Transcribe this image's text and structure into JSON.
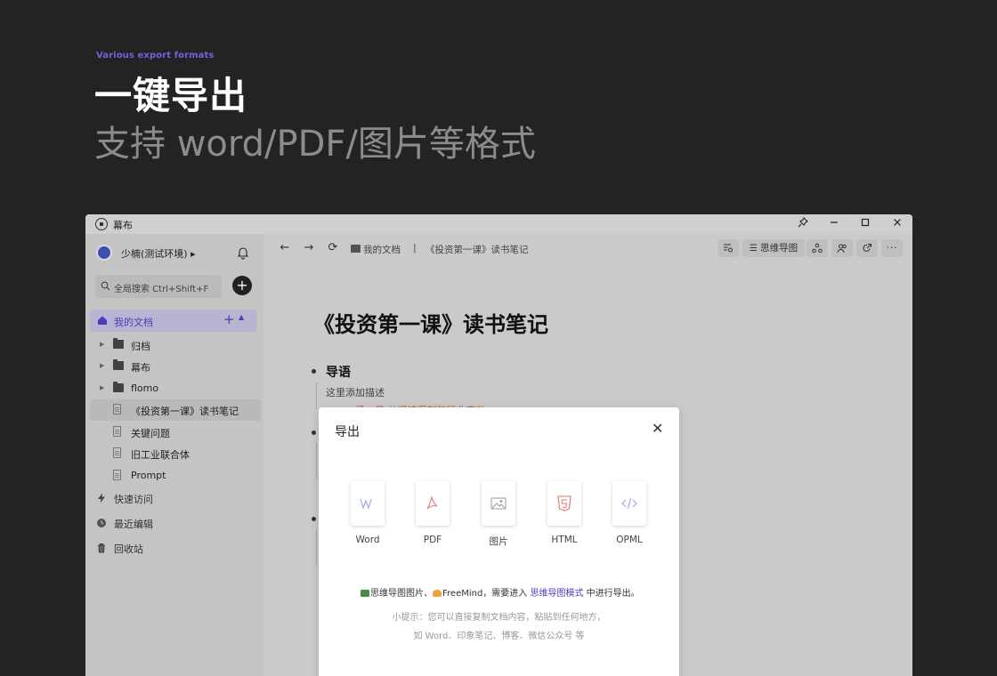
{
  "hero": {
    "tag": "Various export formats",
    "title": "一键导出",
    "subtitle": "支持 word/PDF/图片等格式"
  },
  "window": {
    "app_name": "幕布",
    "controls": [
      "pin-icon",
      "minimize-icon",
      "maximize-icon",
      "close-icon"
    ]
  },
  "sidebar": {
    "user_name": "少楠(测试环境) ▸",
    "search_placeholder": "全局搜索 Ctrl+Shift+F",
    "add_label": "+",
    "my_docs": "我的文档",
    "tree": [
      {
        "label": "归档",
        "type": "folder"
      },
      {
        "label": "幕布",
        "type": "folder"
      },
      {
        "label": "flomo",
        "type": "folder"
      },
      {
        "label": "《投资第一课》读书笔记",
        "type": "doc",
        "selected": true
      },
      {
        "label": "关键问题",
        "type": "doc"
      },
      {
        "label": "旧工业联合体",
        "type": "doc"
      },
      {
        "label": "Prompt",
        "type": "doc"
      }
    ],
    "sections": [
      {
        "label": "快速访问",
        "icon": "lightning-icon"
      },
      {
        "label": "最近编辑",
        "icon": "clock-icon"
      },
      {
        "label": "回收站",
        "icon": "trash-icon"
      }
    ]
  },
  "toolbar": {
    "breadcrumb_root": "我的文档",
    "breadcrumb_sep": "|",
    "breadcrumb_doc": "《投资第一课》读书笔记",
    "mindmap_label": "思维导图"
  },
  "document": {
    "title": "《投资第一课》读书笔记",
    "heading": "导语",
    "description": "这里添加描述",
    "peek_line": "一场一日 从迎接深刻的行业变动"
  },
  "modal": {
    "title": "导出",
    "formats": [
      {
        "label": "Word",
        "icon": "word-file-icon"
      },
      {
        "label": "PDF",
        "icon": "pdf-file-icon"
      },
      {
        "label": "图片",
        "icon": "image-file-icon"
      },
      {
        "label": "HTML",
        "icon": "html5-file-icon"
      },
      {
        "label": "OPML",
        "icon": "code-file-icon"
      }
    ],
    "note_a": "思维导图图片、",
    "note_b": "FreeMind，需要进入 ",
    "note_link": "思维导图模式",
    "note_c": " 中进行导出。",
    "tip_line1": "小提示：您可以直接复制文档内容，粘贴到任何地方，",
    "tip_line2": "如 Word、印象笔记、博客、微信公众号 等"
  },
  "colors": {
    "accent": "#4b3fbf",
    "hero_tag": "#6f63e0",
    "background": "#232323"
  }
}
